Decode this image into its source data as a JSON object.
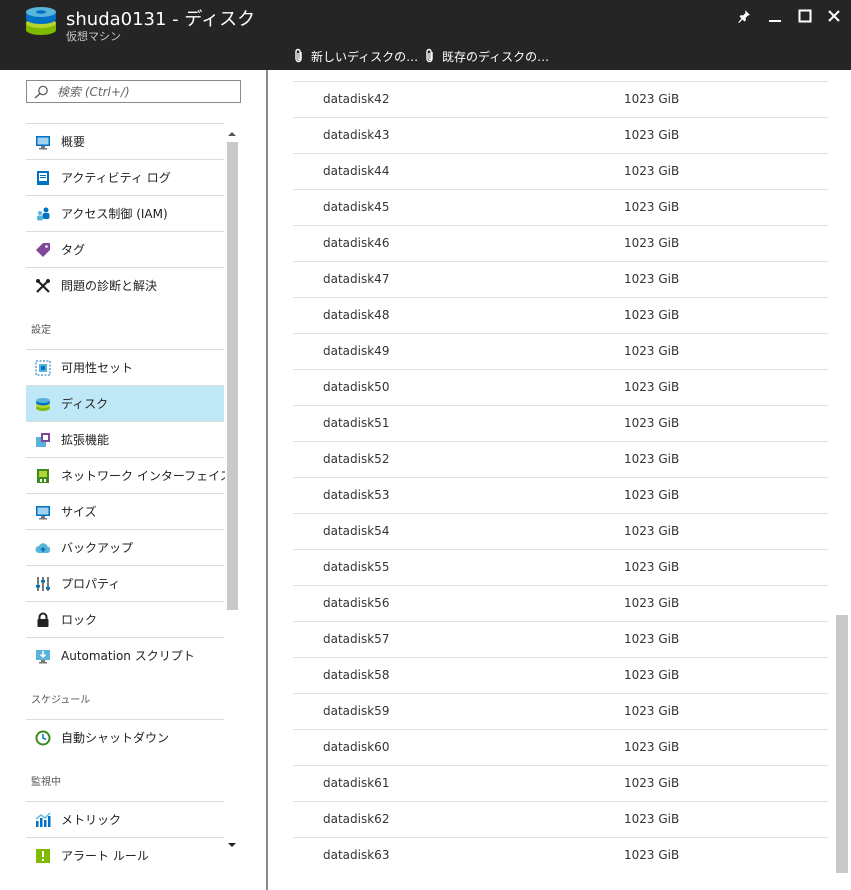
{
  "header": {
    "title": "shuda0131 - ディスク",
    "subtitle": "仮想マシン",
    "commands": [
      {
        "label": "新しいディスクの…",
        "icon": "paperclip-icon"
      },
      {
        "label": "既存のディスクの…",
        "icon": "paperclip-icon"
      }
    ],
    "window_controls": [
      "pin-icon",
      "minimize-icon",
      "maximize-icon",
      "close-icon"
    ]
  },
  "search": {
    "placeholder": "検索 (Ctrl+/)"
  },
  "menu": {
    "group1": [
      {
        "label": "概要",
        "icon": "monitor-overview-icon"
      },
      {
        "label": "アクティビティ ログ",
        "icon": "activity-log-icon"
      },
      {
        "label": "アクセス制御 (IAM)",
        "icon": "users-iam-icon"
      },
      {
        "label": "タグ",
        "icon": "tag-icon"
      },
      {
        "label": "問題の診断と解決",
        "icon": "wrench-tools-icon"
      }
    ],
    "settings_label": "設定",
    "settings": [
      {
        "label": "可用性セット",
        "icon": "availability-set-icon"
      },
      {
        "label": "ディスク",
        "icon": "disk-icon",
        "active": true
      },
      {
        "label": "拡張機能",
        "icon": "extension-icon"
      },
      {
        "label": "ネットワーク インターフェイス",
        "icon": "network-interface-icon"
      },
      {
        "label": "サイズ",
        "icon": "monitor-size-icon"
      },
      {
        "label": "バックアップ",
        "icon": "cloud-backup-icon"
      },
      {
        "label": "プロパティ",
        "icon": "properties-bars-icon"
      },
      {
        "label": "ロック",
        "icon": "lock-icon"
      },
      {
        "label": "Automation スクリプト",
        "icon": "download-monitor-icon"
      }
    ],
    "schedule_label": "スケジュール",
    "schedule": [
      {
        "label": "自動シャットダウン",
        "icon": "clock-icon"
      }
    ],
    "monitoring_label": "監視中",
    "monitoring": [
      {
        "label": "メトリック",
        "icon": "metrics-chart-icon"
      },
      {
        "label": "アラート ルール",
        "icon": "alert-rule-icon"
      }
    ]
  },
  "disks": [
    {
      "name": "datadisk42",
      "size": "1023 GiB"
    },
    {
      "name": "datadisk43",
      "size": "1023 GiB"
    },
    {
      "name": "datadisk44",
      "size": "1023 GiB"
    },
    {
      "name": "datadisk45",
      "size": "1023 GiB"
    },
    {
      "name": "datadisk46",
      "size": "1023 GiB"
    },
    {
      "name": "datadisk47",
      "size": "1023 GiB"
    },
    {
      "name": "datadisk48",
      "size": "1023 GiB"
    },
    {
      "name": "datadisk49",
      "size": "1023 GiB"
    },
    {
      "name": "datadisk50",
      "size": "1023 GiB"
    },
    {
      "name": "datadisk51",
      "size": "1023 GiB"
    },
    {
      "name": "datadisk52",
      "size": "1023 GiB"
    },
    {
      "name": "datadisk53",
      "size": "1023 GiB"
    },
    {
      "name": "datadisk54",
      "size": "1023 GiB"
    },
    {
      "name": "datadisk55",
      "size": "1023 GiB"
    },
    {
      "name": "datadisk56",
      "size": "1023 GiB"
    },
    {
      "name": "datadisk57",
      "size": "1023 GiB"
    },
    {
      "name": "datadisk58",
      "size": "1023 GiB"
    },
    {
      "name": "datadisk59",
      "size": "1023 GiB"
    },
    {
      "name": "datadisk60",
      "size": "1023 GiB"
    },
    {
      "name": "datadisk61",
      "size": "1023 GiB"
    },
    {
      "name": "datadisk62",
      "size": "1023 GiB"
    },
    {
      "name": "datadisk63",
      "size": "1023 GiB"
    }
  ],
  "colors": {
    "header_bg": "#252526",
    "active_item_bg": "#bfe8f7",
    "accent_blue": "#0072c6",
    "disk_green": "#7fba00"
  }
}
